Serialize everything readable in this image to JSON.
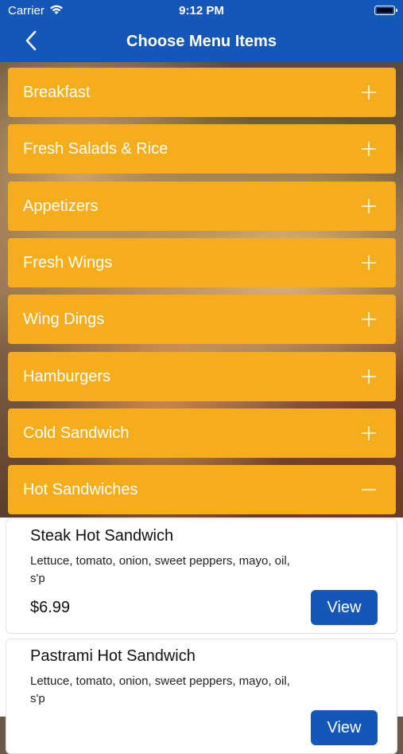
{
  "status_bar": {
    "carrier": "Carrier",
    "time": "9:12 PM"
  },
  "nav": {
    "title": "Choose Menu Items"
  },
  "categories": [
    {
      "label": "Breakfast",
      "expanded": false
    },
    {
      "label": "Fresh Salads & Rice",
      "expanded": false
    },
    {
      "label": "Appetizers",
      "expanded": false
    },
    {
      "label": "Fresh Wings",
      "expanded": false
    },
    {
      "label": "Wing Dings",
      "expanded": false
    },
    {
      "label": "Hamburgers",
      "expanded": false
    },
    {
      "label": "Cold Sandwich",
      "expanded": false
    },
    {
      "label": "Hot Sandwiches",
      "expanded": true
    }
  ],
  "items": [
    {
      "name": "Steak Hot Sandwich",
      "description": " Lettuce, tomato, onion, sweet peppers, mayo, oil, s'p",
      "price": "$6.99",
      "button": "View"
    },
    {
      "name": "Pastrami Hot Sandwich",
      "description": "Lettuce, tomato, onion, sweet peppers, mayo, oil, s'p",
      "price": "",
      "button": "View"
    }
  ],
  "colors": {
    "brand_blue": "#1557b8",
    "category_orange": "#f6ad1b"
  }
}
